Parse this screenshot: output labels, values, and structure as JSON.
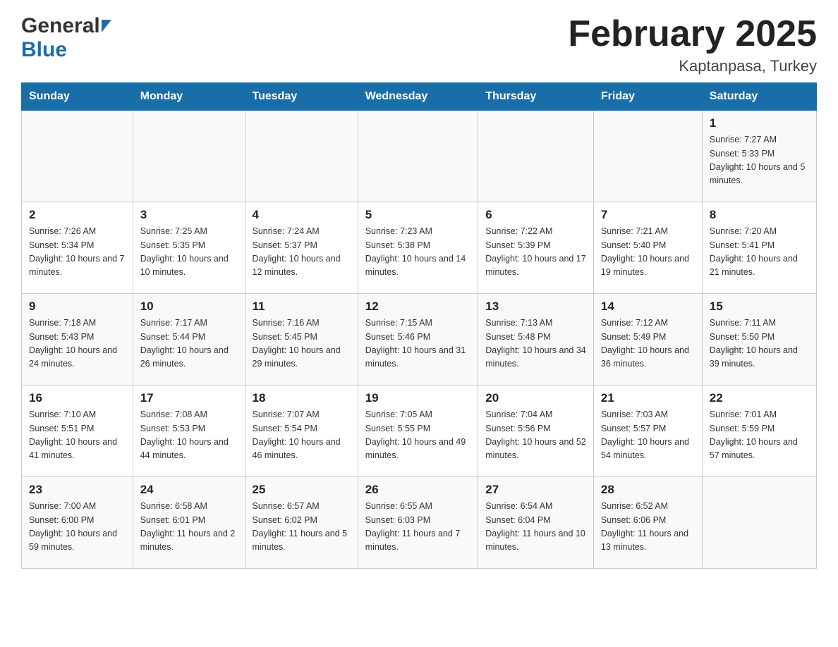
{
  "logo": {
    "general": "General",
    "blue": "Blue"
  },
  "title": {
    "month_year": "February 2025",
    "location": "Kaptanpasa, Turkey"
  },
  "days_of_week": [
    "Sunday",
    "Monday",
    "Tuesday",
    "Wednesday",
    "Thursday",
    "Friday",
    "Saturday"
  ],
  "weeks": [
    [
      {
        "day": "",
        "info": ""
      },
      {
        "day": "",
        "info": ""
      },
      {
        "day": "",
        "info": ""
      },
      {
        "day": "",
        "info": ""
      },
      {
        "day": "",
        "info": ""
      },
      {
        "day": "",
        "info": ""
      },
      {
        "day": "1",
        "info": "Sunrise: 7:27 AM\nSunset: 5:33 PM\nDaylight: 10 hours and 5 minutes."
      }
    ],
    [
      {
        "day": "2",
        "info": "Sunrise: 7:26 AM\nSunset: 5:34 PM\nDaylight: 10 hours and 7 minutes."
      },
      {
        "day": "3",
        "info": "Sunrise: 7:25 AM\nSunset: 5:35 PM\nDaylight: 10 hours and 10 minutes."
      },
      {
        "day": "4",
        "info": "Sunrise: 7:24 AM\nSunset: 5:37 PM\nDaylight: 10 hours and 12 minutes."
      },
      {
        "day": "5",
        "info": "Sunrise: 7:23 AM\nSunset: 5:38 PM\nDaylight: 10 hours and 14 minutes."
      },
      {
        "day": "6",
        "info": "Sunrise: 7:22 AM\nSunset: 5:39 PM\nDaylight: 10 hours and 17 minutes."
      },
      {
        "day": "7",
        "info": "Sunrise: 7:21 AM\nSunset: 5:40 PM\nDaylight: 10 hours and 19 minutes."
      },
      {
        "day": "8",
        "info": "Sunrise: 7:20 AM\nSunset: 5:41 PM\nDaylight: 10 hours and 21 minutes."
      }
    ],
    [
      {
        "day": "9",
        "info": "Sunrise: 7:18 AM\nSunset: 5:43 PM\nDaylight: 10 hours and 24 minutes."
      },
      {
        "day": "10",
        "info": "Sunrise: 7:17 AM\nSunset: 5:44 PM\nDaylight: 10 hours and 26 minutes."
      },
      {
        "day": "11",
        "info": "Sunrise: 7:16 AM\nSunset: 5:45 PM\nDaylight: 10 hours and 29 minutes."
      },
      {
        "day": "12",
        "info": "Sunrise: 7:15 AM\nSunset: 5:46 PM\nDaylight: 10 hours and 31 minutes."
      },
      {
        "day": "13",
        "info": "Sunrise: 7:13 AM\nSunset: 5:48 PM\nDaylight: 10 hours and 34 minutes."
      },
      {
        "day": "14",
        "info": "Sunrise: 7:12 AM\nSunset: 5:49 PM\nDaylight: 10 hours and 36 minutes."
      },
      {
        "day": "15",
        "info": "Sunrise: 7:11 AM\nSunset: 5:50 PM\nDaylight: 10 hours and 39 minutes."
      }
    ],
    [
      {
        "day": "16",
        "info": "Sunrise: 7:10 AM\nSunset: 5:51 PM\nDaylight: 10 hours and 41 minutes."
      },
      {
        "day": "17",
        "info": "Sunrise: 7:08 AM\nSunset: 5:53 PM\nDaylight: 10 hours and 44 minutes."
      },
      {
        "day": "18",
        "info": "Sunrise: 7:07 AM\nSunset: 5:54 PM\nDaylight: 10 hours and 46 minutes."
      },
      {
        "day": "19",
        "info": "Sunrise: 7:05 AM\nSunset: 5:55 PM\nDaylight: 10 hours and 49 minutes."
      },
      {
        "day": "20",
        "info": "Sunrise: 7:04 AM\nSunset: 5:56 PM\nDaylight: 10 hours and 52 minutes."
      },
      {
        "day": "21",
        "info": "Sunrise: 7:03 AM\nSunset: 5:57 PM\nDaylight: 10 hours and 54 minutes."
      },
      {
        "day": "22",
        "info": "Sunrise: 7:01 AM\nSunset: 5:59 PM\nDaylight: 10 hours and 57 minutes."
      }
    ],
    [
      {
        "day": "23",
        "info": "Sunrise: 7:00 AM\nSunset: 6:00 PM\nDaylight: 10 hours and 59 minutes."
      },
      {
        "day": "24",
        "info": "Sunrise: 6:58 AM\nSunset: 6:01 PM\nDaylight: 11 hours and 2 minutes."
      },
      {
        "day": "25",
        "info": "Sunrise: 6:57 AM\nSunset: 6:02 PM\nDaylight: 11 hours and 5 minutes."
      },
      {
        "day": "26",
        "info": "Sunrise: 6:55 AM\nSunset: 6:03 PM\nDaylight: 11 hours and 7 minutes."
      },
      {
        "day": "27",
        "info": "Sunrise: 6:54 AM\nSunset: 6:04 PM\nDaylight: 11 hours and 10 minutes."
      },
      {
        "day": "28",
        "info": "Sunrise: 6:52 AM\nSunset: 6:06 PM\nDaylight: 11 hours and 13 minutes."
      },
      {
        "day": "",
        "info": ""
      }
    ]
  ]
}
